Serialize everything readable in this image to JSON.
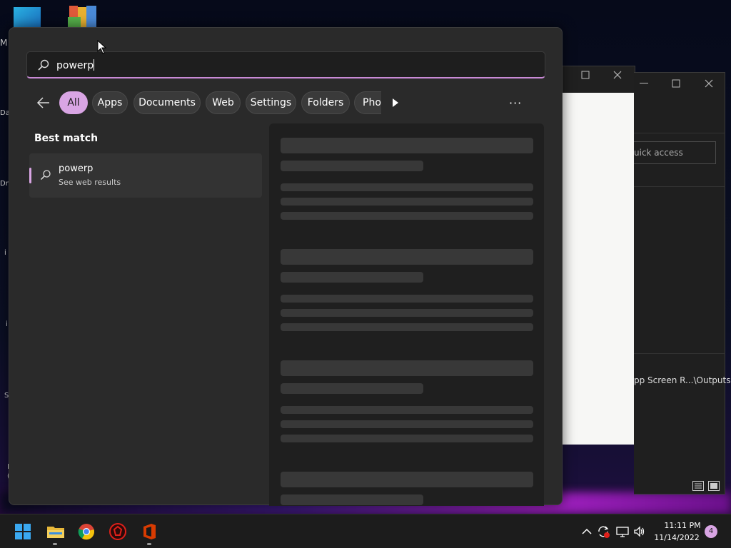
{
  "search": {
    "query": "powerp"
  },
  "filters": {
    "chips": [
      "All",
      "Apps",
      "Documents",
      "Web",
      "Settings",
      "Folders",
      "Pho"
    ],
    "active": "All"
  },
  "results": {
    "section_label": "Best match",
    "best_match": {
      "title": "powerp",
      "subtitle": "See web results"
    }
  },
  "background_windows": {
    "explorer_search_placeholder": "uick access",
    "explorer_path": "pp Screen R...\\Outputs"
  },
  "desktop": {
    "icon_labels": [
      "M",
      "Da",
      "Dr",
      "i",
      "i",
      "S",
      "I",
      "("
    ]
  },
  "taskbar": {
    "apps": [
      "start-button",
      "file-explorer",
      "chrome",
      "antivirus-app",
      "office-app"
    ],
    "time": "11:11 PM",
    "date": "11/14/2022",
    "notification_count": "4"
  },
  "colors": {
    "accent": "#d9a5e4",
    "panel": "#2a2a2a",
    "preview": "#1f1f1f"
  }
}
